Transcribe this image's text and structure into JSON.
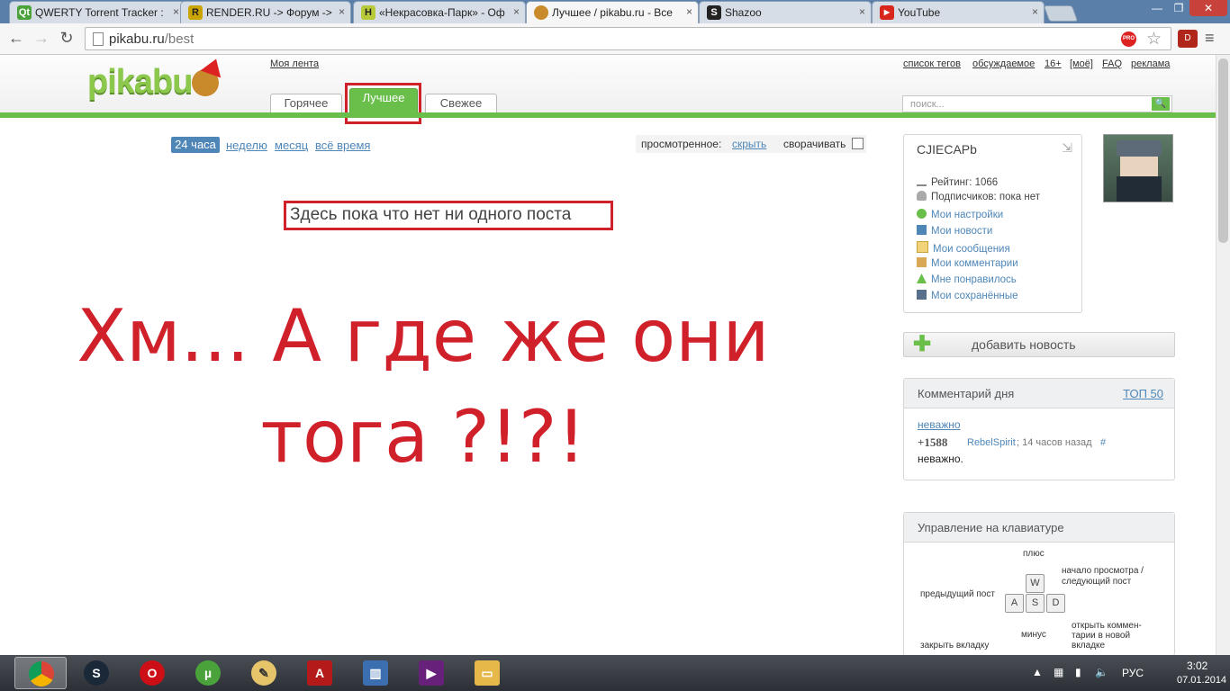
{
  "browser": {
    "tabs": [
      {
        "title": "QWERTY Torrent Tracker :",
        "icon": "qt-icon",
        "active": false
      },
      {
        "title": "RENDER.RU -> Форум ->",
        "icon": "render-icon",
        "active": false
      },
      {
        "title": "«Некрасовка-Парк» - Оф",
        "icon": "h-icon",
        "active": false
      },
      {
        "title": "Лучшее / pikabu.ru - Все",
        "icon": "pikabu-icon",
        "active": true
      },
      {
        "title": "Shazoo",
        "icon": "shazoo-icon",
        "active": false
      },
      {
        "title": "YouTube",
        "icon": "youtube-icon",
        "active": false
      }
    ],
    "url_host": "pikabu.ru",
    "url_path": "/best",
    "pro_badge": "PRO"
  },
  "header": {
    "logo_text": "pikabu",
    "my_feed": "Моя лента",
    "nav_links": [
      "список тегов",
      "обсуждаемое",
      "16+",
      "[моё]",
      "FAQ",
      "реклама"
    ],
    "tabs": [
      "Горячее",
      "Лучшее",
      "Свежее"
    ],
    "search_placeholder": "поиск..."
  },
  "filters": {
    "active": "24 часа",
    "links": [
      "неделю",
      "месяц",
      "всё время"
    ],
    "viewed_label": "просмотренное:",
    "viewed_hide": "скрыть",
    "collapse_label": "сворачивать"
  },
  "main": {
    "empty_message": "Здесь пока что нет ни одного поста",
    "overlay_line1": "Хм... А где же они",
    "overlay_line2": "тога ?!?!"
  },
  "user": {
    "name": "CJIECAPb",
    "rating": "Рейтинг: 1066",
    "subscribers": "Подписчиков: пока нет",
    "links": [
      "Мои настройки",
      "Мои новости",
      "Мои сообщения",
      "Мои комментарии",
      "Мне понравилось",
      "Мои сохранённые"
    ]
  },
  "add_news": "добавить новость",
  "comment_day": {
    "title": "Комментарий дня",
    "top_link": "ТОП 50",
    "post_link": "неважно",
    "score": "+1588",
    "author": "RebelSpirit",
    "time": "; 14 часов назад",
    "hash": "#",
    "text": "неважно."
  },
  "keyboard": {
    "title": "Управление на клавиатуре",
    "keys": [
      "W",
      "A",
      "S",
      "D"
    ],
    "plus": "плюс",
    "minus": "минус",
    "prev": "предыдущий пост",
    "next": "начало просмотра / следующий пост",
    "open_comments": "открыть коммен-тарии в новой вкладке",
    "close_tab": "закрыть вкладку"
  },
  "taskbar": {
    "apps": [
      "chrome",
      "steam",
      "opera",
      "utorrent",
      "paint",
      "autocad",
      "unknown",
      "visualstudio",
      "explorer"
    ],
    "lang": "РУС",
    "time": "3:02",
    "date": "07.01.2014"
  },
  "colors": {
    "accent_green": "#6abf4b",
    "link_blue": "#4e86b8",
    "annotation_red": "#d0202a"
  }
}
